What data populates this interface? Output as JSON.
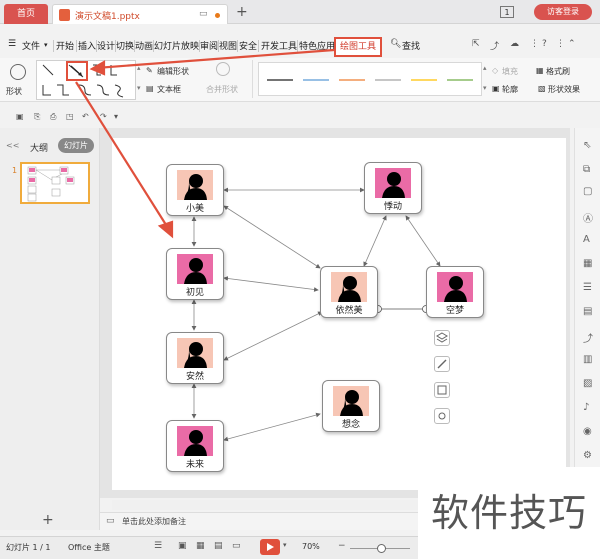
{
  "titlebar": {
    "home_tab": "首页",
    "doc_tab": "演示文稿1.pptx",
    "add_tab": "+",
    "window_count": "1",
    "login": "访客登录"
  },
  "menu": {
    "file": "文件",
    "items": [
      "开始",
      "插入",
      "设计",
      "切换",
      "动画",
      "幻灯片放映",
      "审阅",
      "视图",
      "安全",
      "开发工具",
      "特色应用"
    ],
    "active": "绘图工具",
    "search": "查找"
  },
  "ribbon": {
    "shape_label": "形状",
    "edit_shape": "编辑形状",
    "text_box": "文本框",
    "merge_shape": "合并形状",
    "fill": "填充",
    "format_brush": "格式刷",
    "outline": "轮廓",
    "shape_effect": "形状效果",
    "colors": {
      "accent": "#e0503c",
      "line1": "#222222",
      "line2": "#5b9bd5",
      "line3": "#ed7d31",
      "line4": "#a5a5a5",
      "line5": "#ffc000",
      "line6": "#70ad47"
    }
  },
  "leftpanel": {
    "collapse": "<<",
    "outline_tab": "大纲",
    "slides_tab": "幻灯片",
    "slide_number": "1",
    "add_slide": "+"
  },
  "diagram": {
    "nodes": [
      {
        "id": "xiaomei",
        "label": "小美",
        "color": "peach"
      },
      {
        "id": "chujian",
        "label": "初见",
        "color": "pink"
      },
      {
        "id": "anran",
        "label": "安然",
        "color": "peach"
      },
      {
        "id": "weilai",
        "label": "未来",
        "color": "pink"
      },
      {
        "id": "zhengdong",
        "label": "悸动",
        "color": "pink"
      },
      {
        "id": "yiranmei",
        "label": "依然美",
        "color": "peach"
      },
      {
        "id": "kongmeng",
        "label": "空梦",
        "color": "pink"
      },
      {
        "id": "xiangnian",
        "label": "想念",
        "color": "peach"
      }
    ]
  },
  "notes": {
    "placeholder": "单击此处添加备注"
  },
  "status": {
    "slide_count": "幻灯片 1 / 1",
    "theme": "Office 主题",
    "zoom": "70%"
  },
  "watermark": "软件技巧"
}
